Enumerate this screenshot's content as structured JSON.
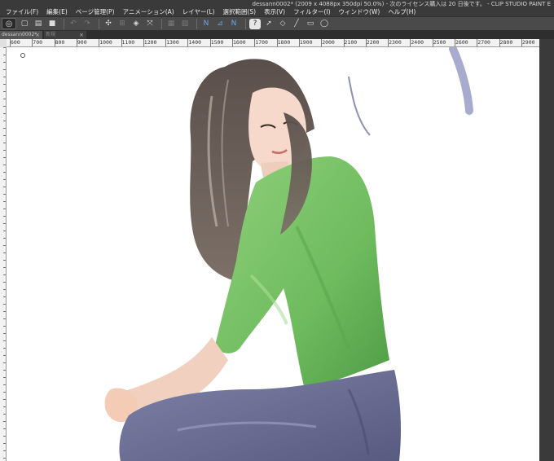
{
  "window": {
    "title": "dessann0002* (2009 x 4088px 350dpi 50.0%) - 次のライセンス購入は 20 日後です。 - CLIP STUDIO PAINT E"
  },
  "menu": {
    "items": [
      "ファイル(F)",
      "編集(E)",
      "ページ管理(P)",
      "アニメーション(A)",
      "レイヤー(L)",
      "選択範囲(S)",
      "表示(V)",
      "フィルター(I)",
      "ウィンドウ(W)",
      "ヘルプ(H)"
    ]
  },
  "toolbar": {
    "icons": [
      "logo-icon",
      "new-file-icon",
      "open-file-icon",
      "save-icon",
      "undo-icon",
      "redo-icon",
      "transform-icon",
      "scale-icon",
      "fill-icon",
      "move-icon",
      "grid-icon",
      "ruler-icon",
      "snap-ruler-icon",
      "snap-grid-icon",
      "snap-special-icon",
      "help-icon",
      "select-icon",
      "eraser-icon",
      "line-icon",
      "rect-icon",
      "lasso-icon"
    ]
  },
  "tabs": [
    {
      "label": "dessann0002*"
    },
    {
      "label": "新規"
    }
  ],
  "ruler": {
    "ticks": [
      "600",
      "700",
      "800",
      "900",
      "1000",
      "1100",
      "1200",
      "1300",
      "1400",
      "1500",
      "1600",
      "1700",
      "1800",
      "1900",
      "2000",
      "2100",
      "2200",
      "2300",
      "2400",
      "2500",
      "2600",
      "2700",
      "2800",
      "2900"
    ]
  },
  "canvas": {
    "background": "#ffffff",
    "accent_colors": {
      "sweater": "#7dc46a",
      "jeans": "#6c6e96",
      "hair": "#5e524c",
      "skin": "#f4d6c6"
    }
  }
}
